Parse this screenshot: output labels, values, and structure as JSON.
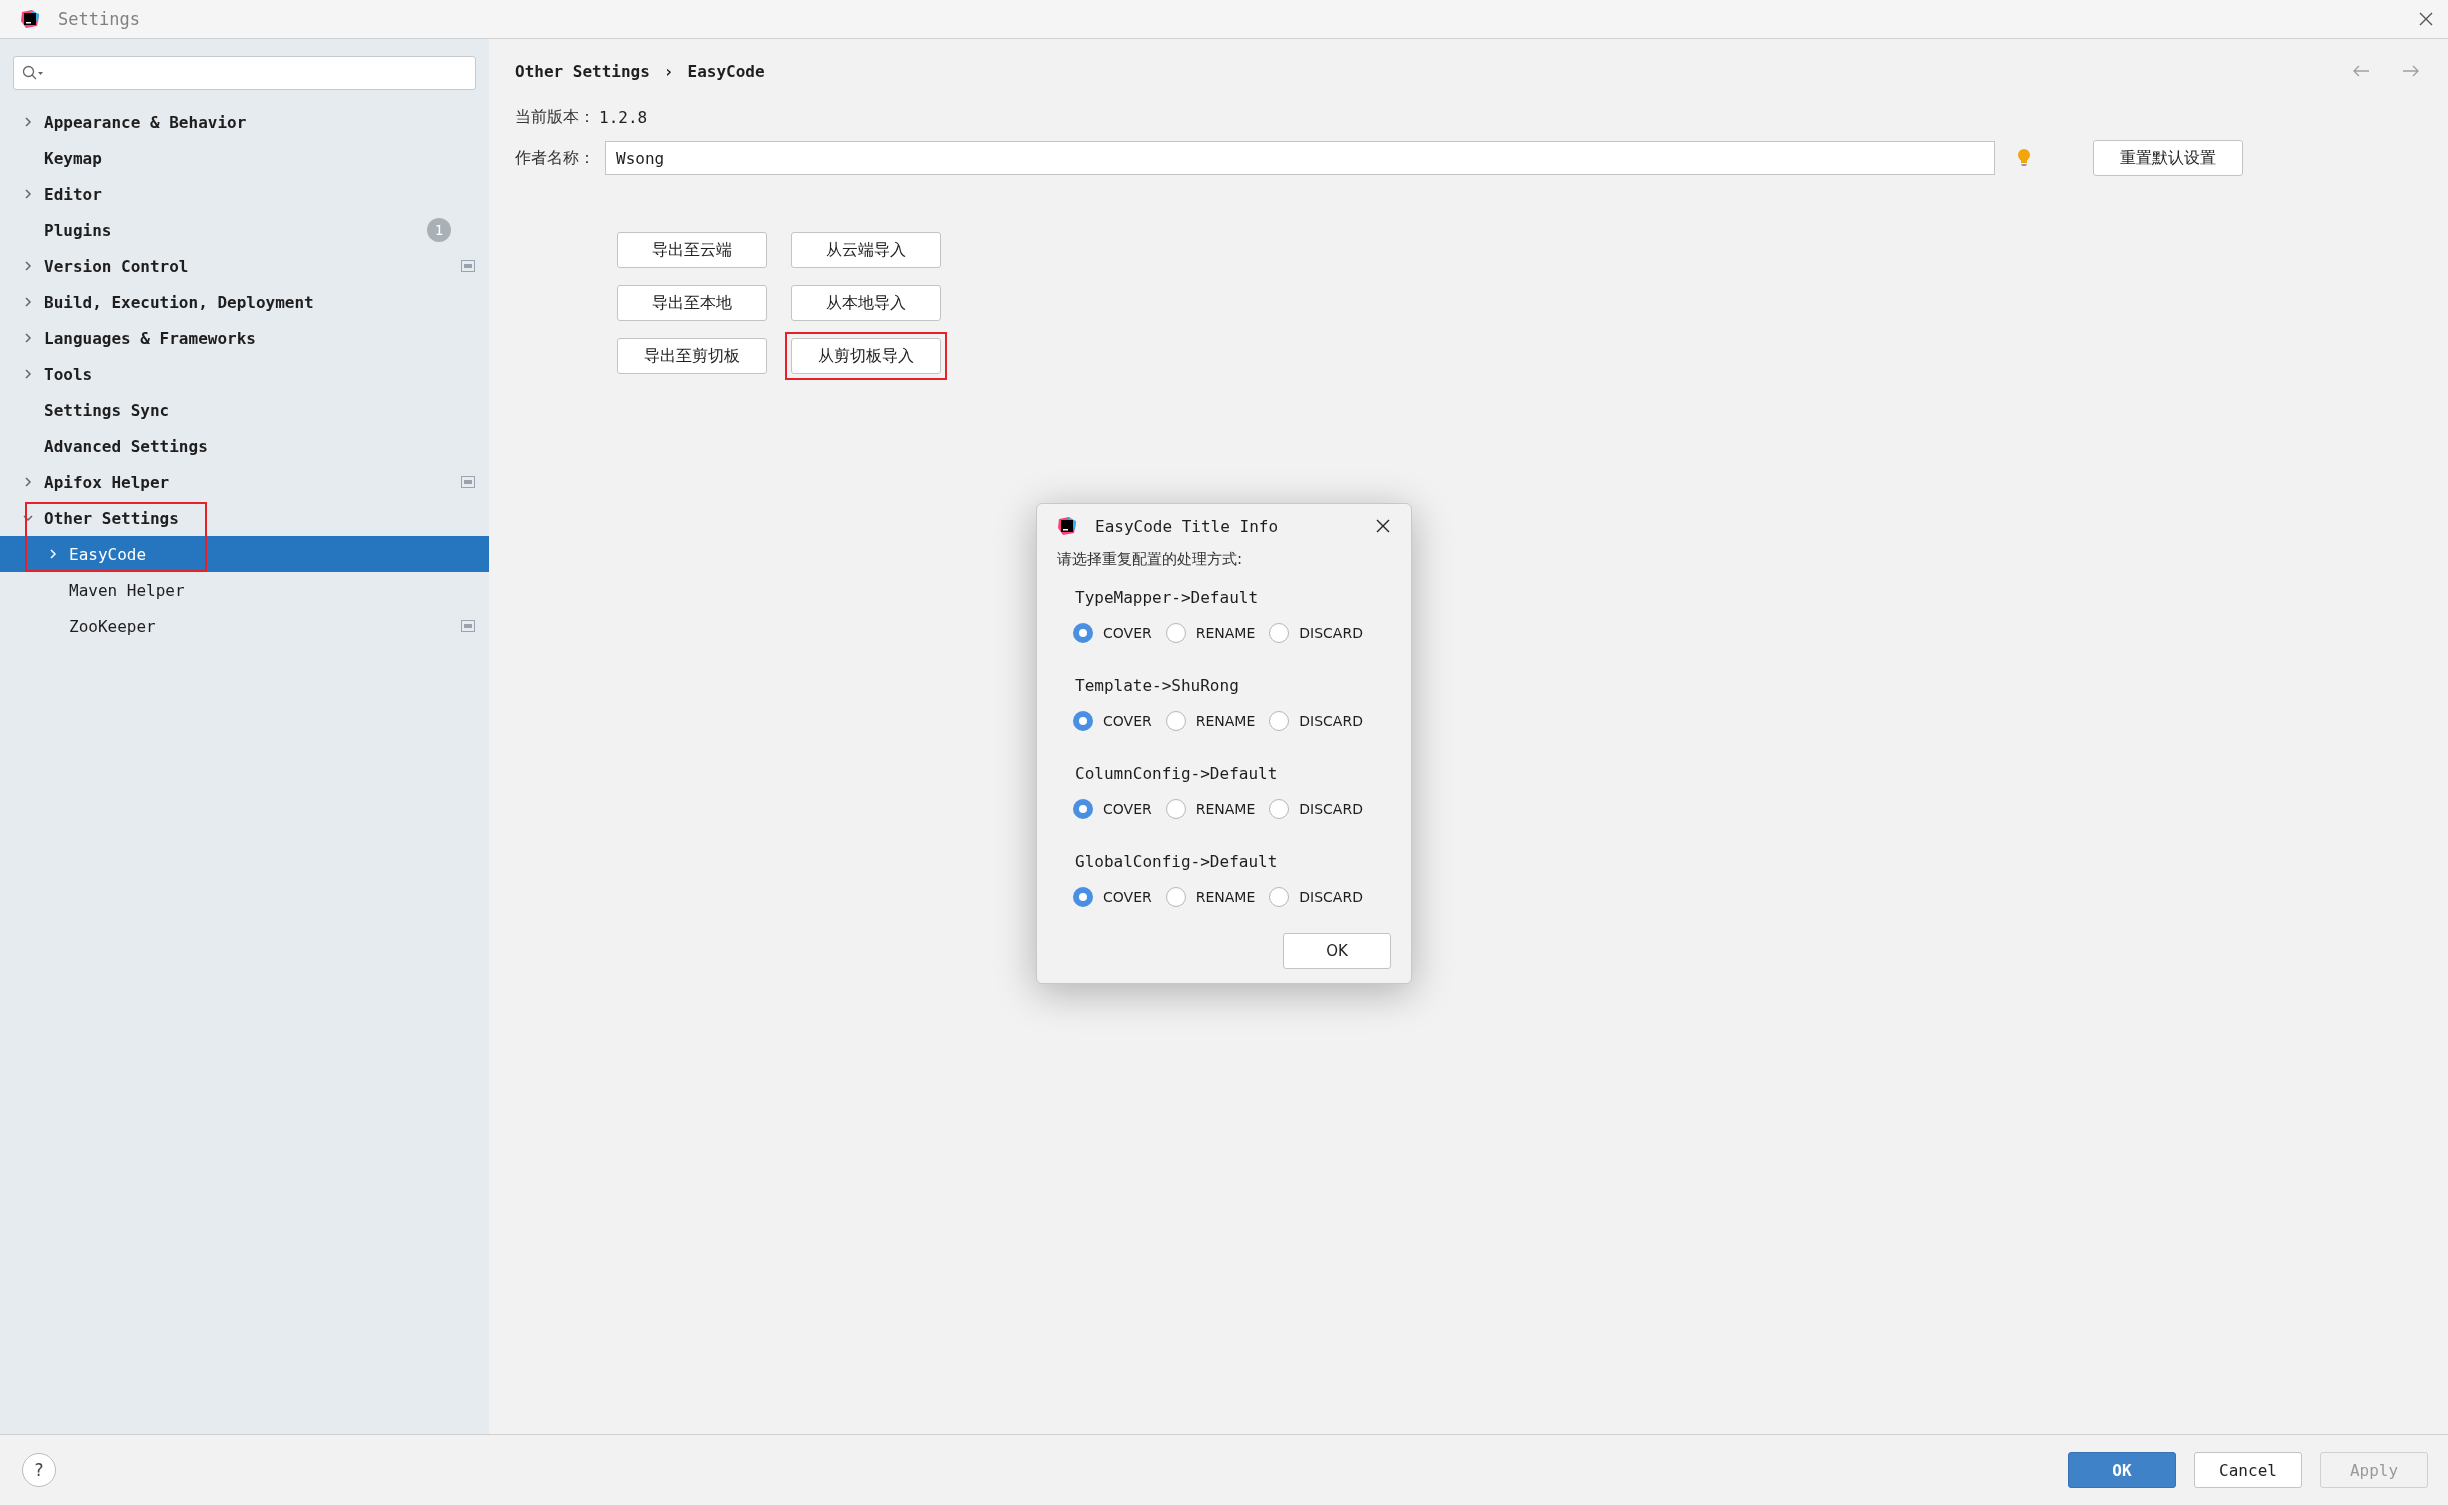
{
  "window": {
    "title": "Settings"
  },
  "sidebar": {
    "items": [
      {
        "label": "Appearance & Behavior",
        "expanded": false,
        "selected": false
      },
      {
        "label": "Keymap",
        "selected": false
      },
      {
        "label": "Editor",
        "expanded": false,
        "selected": false
      },
      {
        "label": "Plugins",
        "selected": false,
        "badge": "1"
      },
      {
        "label": "Version Control",
        "expanded": false,
        "selected": false,
        "project_icon": true
      },
      {
        "label": "Build, Execution, Deployment",
        "expanded": false,
        "selected": false
      },
      {
        "label": "Languages & Frameworks",
        "expanded": false,
        "selected": false
      },
      {
        "label": "Tools",
        "expanded": false,
        "selected": false
      },
      {
        "label": "Settings Sync",
        "selected": false
      },
      {
        "label": "Advanced Settings",
        "selected": false
      },
      {
        "label": "Apifox Helper",
        "expanded": false,
        "selected": false,
        "project_icon": true
      },
      {
        "label": "Other Settings",
        "expanded": true,
        "selected": false,
        "highlighted": true,
        "children": [
          {
            "label": "EasyCode",
            "expanded": false,
            "selected": true
          },
          {
            "label": "Maven Helper",
            "selected": false
          },
          {
            "label": "ZooKeeper",
            "selected": false,
            "project_icon": true
          }
        ]
      }
    ]
  },
  "breadcrumb": {
    "parts": [
      "Other Settings",
      "EasyCode"
    ],
    "separator": "›"
  },
  "version": {
    "label": "当前版本：",
    "value": "1.2.8"
  },
  "author": {
    "label": "作者名称：",
    "value": "Wsong"
  },
  "reset_button": "重置默认设置",
  "action_buttons": [
    {
      "label": "导出至云端"
    },
    {
      "label": "从云端导入"
    },
    {
      "label": "导出至本地"
    },
    {
      "label": "从本地导入"
    },
    {
      "label": "导出至剪切板"
    },
    {
      "label": "从剪切板导入",
      "highlighted": true
    }
  ],
  "dialog": {
    "title": "EasyCode Title Info",
    "prompt": "请选择重复配置的处理方式:",
    "groups": [
      {
        "name": "TypeMapper->Default",
        "options": [
          {
            "label": "COVER",
            "selected": true
          },
          {
            "label": "RENAME",
            "selected": false
          },
          {
            "label": "DISCARD",
            "selected": false
          }
        ]
      },
      {
        "name": "Template->ShuRong",
        "options": [
          {
            "label": "COVER",
            "selected": true
          },
          {
            "label": "RENAME",
            "selected": false
          },
          {
            "label": "DISCARD",
            "selected": false
          }
        ]
      },
      {
        "name": "ColumnConfig->Default",
        "options": [
          {
            "label": "COVER",
            "selected": true
          },
          {
            "label": "RENAME",
            "selected": false
          },
          {
            "label": "DISCARD",
            "selected": false
          }
        ]
      },
      {
        "name": "GlobalConfig->Default",
        "options": [
          {
            "label": "COVER",
            "selected": true
          },
          {
            "label": "RENAME",
            "selected": false
          },
          {
            "label": "DISCARD",
            "selected": false
          }
        ]
      }
    ],
    "ok_button": "OK"
  },
  "footer": {
    "help": "?",
    "buttons": [
      {
        "label": "OK",
        "kind": "primary"
      },
      {
        "label": "Cancel",
        "kind": "default"
      },
      {
        "label": "Apply",
        "kind": "disabled"
      }
    ]
  }
}
